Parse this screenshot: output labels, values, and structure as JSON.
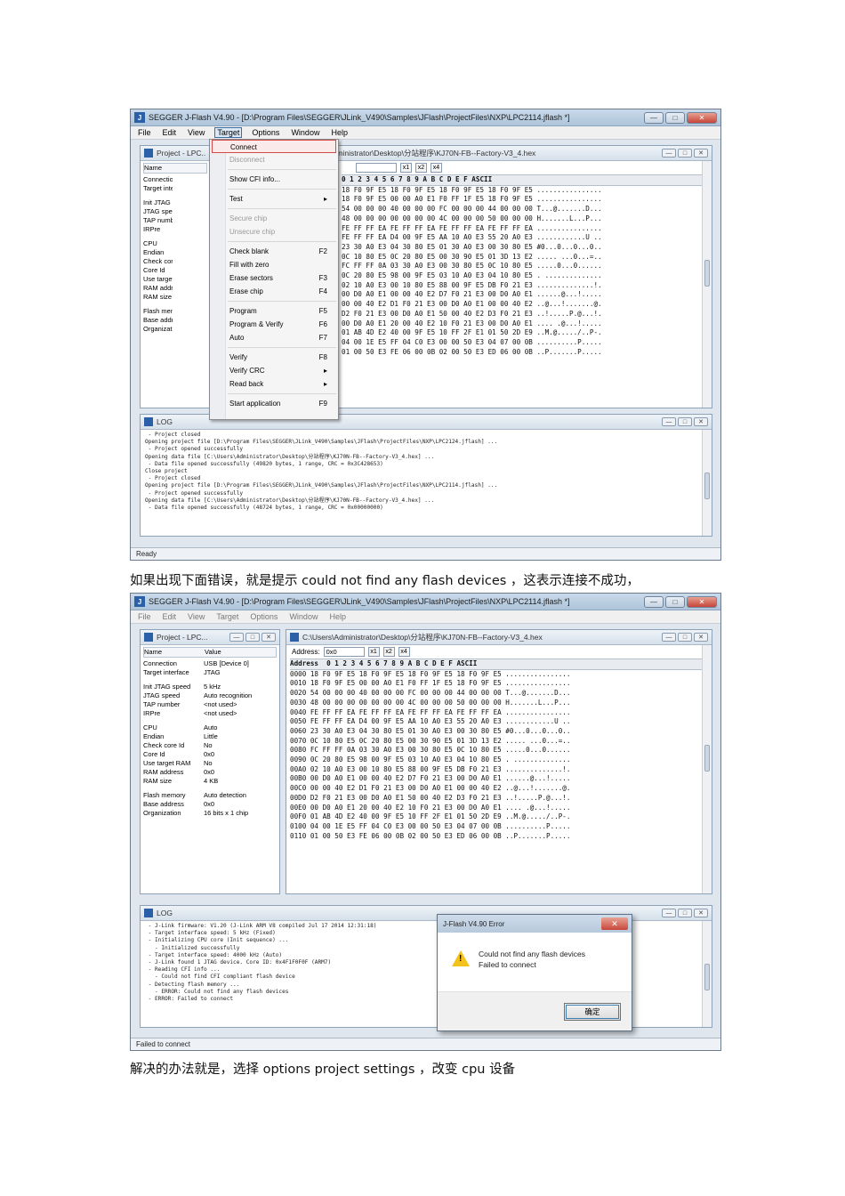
{
  "screenshot1": {
    "title": "SEGGER J-Flash V4.90 - [D:\\Program Files\\SEGGER\\JLink_V490\\Samples\\JFlash\\ProjectFiles\\NXP\\LPC2114.jflash *]",
    "menu": [
      "File",
      "Edit",
      "View",
      "Target",
      "Options",
      "Window",
      "Help"
    ],
    "active_menu": "Target",
    "project_title": "Project - LPC...",
    "project_rows": [
      [
        "Name",
        ""
      ],
      [
        "Connection",
        ""
      ],
      [
        "Target interface",
        ""
      ],
      [
        "",
        ""
      ],
      [
        "Init JTAG speed",
        ""
      ],
      [
        "JTAG speed",
        ""
      ],
      [
        "TAP number",
        ""
      ],
      [
        "IRPre",
        ""
      ],
      [
        "",
        ""
      ],
      [
        "CPU",
        ""
      ],
      [
        "Endian",
        ""
      ],
      [
        "Check core Id",
        ""
      ],
      [
        "Core Id",
        ""
      ],
      [
        "Use target RAM",
        ""
      ],
      [
        "RAM address",
        ""
      ],
      [
        "RAM size",
        ""
      ],
      [
        "",
        ""
      ],
      [
        "Flash memory",
        ""
      ],
      [
        "Base address",
        ""
      ],
      [
        "Organization",
        ""
      ]
    ],
    "hex_title": "Administrator\\Desktop\\分站程序\\KJ70N-FB--Factory-V3_4.hex",
    "address_value": "",
    "zoom": [
      "x1",
      "x2",
      "x4"
    ],
    "hex_header": "0 1 2 3 4 5 6 7 8 9 A B C D E F ASCII",
    "hex_lines": [
      "18 F0 9F E5 18 F0 9F E5 18 F0 9F E5 18 F0 9F E5 ................",
      "18 F0 9F E5 00 00 A0 E1 F0 FF 1F E5 18 F0 9F E5 ................",
      "54 00 00 00 40 00 00 00 FC 00 00 00 44 00 00 00 T...@.......D...",
      "48 00 00 00 00 00 00 00 4C 00 00 00 50 00 00 00 H.......L...P...",
      "FE FF FF EA FE FF FF EA FE FF FF EA FE FF FF EA ................",
      "FE FF FF EA D4 00 9F E5 AA 10 A0 E3 55 20 A0 E3 ............U ..",
      "23 30 A0 E3 04 30 80 E5 01 30 A0 E3 00 30 80 E5 #0...0...0...0..",
      "0C 10 80 E5 0C 20 80 E5 00 30 90 E5 01 3D 13 E2 ..... ...0...=..",
      "FC FF FF 0A 03 30 A0 E3 00 30 80 E5 0C 10 80 E5 .....0...0......",
      "0C 20 80 E5 98 00 9F E5 03 10 A0 E3 04 10 80 E5 . ..............",
      "02 10 A0 E3 00 10 80 E5 88 00 9F E5 DB F0 21 E3 ..............!.",
      "00 D0 A0 E1 00 00 40 E2 D7 F0 21 E3 00 D0 A0 E1 ......@...!.....",
      "00 00 40 E2 D1 F0 21 E3 00 D0 A0 E1 00 00 40 E2 ..@...!.......@.",
      "D2 F0 21 E3 00 D0 A0 E1 50 00 40 E2 D3 F0 21 E3 ..!.....P.@...!.",
      "00 D0 A0 E1 20 00 40 E2 10 F0 21 E3 00 D0 A0 E1 .... .@...!.....",
      "01 AB 4D E2 40 00 9F E5 10 FF 2F E1 01 50 2D E9 ..M.@...../..P-.",
      "04 00 1E E5 FF 04 C0 E3 00 00 50 E3 04 07 00 0B ..........P.....",
      "01 00 50 E3 FE 06 00 0B 02 00 50 E3 ED 06 00 0B ..P.......P....."
    ],
    "dropdown": [
      {
        "label": "Connect",
        "shortcut": "",
        "state": "highlighted"
      },
      {
        "label": "Disconnect",
        "shortcut": "",
        "state": "disabled"
      },
      {
        "sep": true
      },
      {
        "label": "Show CFI info...",
        "shortcut": "",
        "state": ""
      },
      {
        "sep": true
      },
      {
        "label": "Test",
        "shortcut": "▸",
        "state": ""
      },
      {
        "sep": true
      },
      {
        "label": "Secure chip",
        "shortcut": "",
        "state": "disabled"
      },
      {
        "label": "Unsecure chip",
        "shortcut": "",
        "state": "disabled"
      },
      {
        "sep": true
      },
      {
        "label": "Check blank",
        "shortcut": "F2",
        "state": ""
      },
      {
        "label": "Fill with zero",
        "shortcut": "",
        "state": ""
      },
      {
        "label": "Erase sectors",
        "shortcut": "F3",
        "state": ""
      },
      {
        "label": "Erase chip",
        "shortcut": "F4",
        "state": ""
      },
      {
        "sep": true
      },
      {
        "label": "Program",
        "shortcut": "F5",
        "state": ""
      },
      {
        "label": "Program & Verify",
        "shortcut": "F6",
        "state": ""
      },
      {
        "label": "Auto",
        "shortcut": "F7",
        "state": ""
      },
      {
        "sep": true
      },
      {
        "label": "Verify",
        "shortcut": "F8",
        "state": ""
      },
      {
        "label": "Verify CRC",
        "shortcut": "▸",
        "state": ""
      },
      {
        "label": "Read back",
        "shortcut": "▸",
        "state": ""
      },
      {
        "sep": true
      },
      {
        "label": "Start application",
        "shortcut": "F9",
        "state": ""
      }
    ],
    "log_title": "LOG",
    "log_lines": [
      " - Project closed",
      "Opening project file [D:\\Program Files\\SEGGER\\JLink_V490\\Samples\\JFlash\\ProjectFiles\\NXP\\LPC2124.jflash] ...",
      " - Project opened successfully",
      "Opening data file [C:\\Users\\Administrator\\Desktop\\分站程序\\KJ70N-FB--Factory-V3_4.hex] ...",
      " - Data file opened successfully (49820 bytes, 1 range, CRC = 0x3C428653)",
      "Close project",
      " - Project closed",
      "Opening project file [D:\\Program Files\\SEGGER\\JLink_V490\\Samples\\JFlash\\ProjectFiles\\NXP\\LPC2114.jflash] ...",
      " - Project opened successfully",
      "Opening data file [C:\\Users\\Administrator\\Desktop\\分站程序\\KJ70N-FB--Factory-V3_4.hex] ...",
      " - Data file opened successfully (48724 bytes, 1 range, CRC = 0x00000000)"
    ],
    "status": "Ready"
  },
  "caption1": "如果出现下面错误，就是提示 could not find any flash devices ，这表示连接不成功，",
  "screenshot2": {
    "title": "SEGGER J-Flash V4.90 - [D:\\Program Files\\SEGGER\\JLink_V490\\Samples\\JFlash\\ProjectFiles\\NXP\\LPC2114.jflash *]",
    "menu": [
      "File",
      "Edit",
      "View",
      "Target",
      "Options",
      "Window",
      "Help"
    ],
    "project_title": "Project - LPC...",
    "project_rows": [
      [
        "Name",
        "Value"
      ],
      [
        "Connection",
        "USB [Device 0]"
      ],
      [
        "Target interface",
        "JTAG"
      ],
      [
        "",
        ""
      ],
      [
        "Init JTAG speed",
        "5 kHz"
      ],
      [
        "JTAG speed",
        "Auto recognition"
      ],
      [
        "TAP number",
        "<not used>"
      ],
      [
        "IRPre",
        "<not used>"
      ],
      [
        "",
        ""
      ],
      [
        "CPU",
        "Auto"
      ],
      [
        "Endian",
        "Little"
      ],
      [
        "Check core Id",
        "No"
      ],
      [
        "Core Id",
        "0x0"
      ],
      [
        "Use target RAM",
        "No"
      ],
      [
        "RAM address",
        "0x0"
      ],
      [
        "RAM size",
        "4 KB"
      ],
      [
        "",
        ""
      ],
      [
        "Flash memory",
        "Auto detection"
      ],
      [
        "Base address",
        "0x0"
      ],
      [
        "Organization",
        "16 bits x 1 chip"
      ]
    ],
    "hex_title": "C:\\Users\\Administrator\\Desktop\\分站程序\\KJ70N-FB--Factory-V3_4.hex",
    "address_label": "Address:",
    "address_value": "0x0",
    "zoom": [
      "x1",
      "x2",
      "x4"
    ],
    "hex_header": "Address  0 1 2 3 4 5 6 7 8 9 A B C D E F ASCII",
    "hex_lines": [
      "0000 18 F0 9F E5 18 F0 9F E5 18 F0 9F E5 18 F0 9F E5 ................",
      "0010 18 F0 9F E5 00 00 A0 E1 F0 FF 1F E5 18 F0 9F E5 ................",
      "0020 54 00 00 00 40 00 00 00 FC 00 00 00 44 00 00 00 T...@.......D...",
      "0030 48 00 00 00 00 00 00 00 4C 00 00 00 50 00 00 00 H.......L...P...",
      "0040 FE FF FF EA FE FF FF EA FE FF FF EA FE FF FF EA ................",
      "0050 FE FF FF EA D4 00 9F E5 AA 10 A0 E3 55 20 A0 E3 ............U ..",
      "0060 23 30 A0 E3 04 30 80 E5 01 30 A0 E3 00 30 80 E5 #0...0...0...0..",
      "0070 0C 10 80 E5 0C 20 80 E5 00 30 90 E5 01 3D 13 E2 ..... ...0...=..",
      "0080 FC FF FF 0A 03 30 A0 E3 00 30 80 E5 0C 10 80 E5 .....0...0......",
      "0090 0C 20 80 E5 98 00 9F E5 03 10 A0 E3 04 10 80 E5 . ..............",
      "00A0 02 10 A0 E3 00 10 80 E5 88 00 9F E5 DB F0 21 E3 ..............!.",
      "00B0 00 D0 A0 E1 00 00 40 E2 D7 F0 21 E3 00 D0 A0 E1 ......@...!.....",
      "00C0 00 00 40 E2 D1 F0 21 E3 00 D0 A0 E1 00 00 40 E2 ..@...!.......@.",
      "00D0 D2 F0 21 E3 00 D0 A0 E1 50 00 40 E2 D3 F0 21 E3 ..!.....P.@...!.",
      "00E0 00 D0 A0 E1 20 00 40 E2 10 F0 21 E3 00 D0 A0 E1 .... .@...!.....",
      "00F0 01 AB 4D E2 40 00 9F E5 10 FF 2F E1 01 50 2D E9 ..M.@...../..P-.",
      "0100 04 00 1E E5 FF 04 C0 E3 00 00 50 E3 04 07 00 0B ..........P.....",
      "0110 01 00 50 E3 FE 06 00 0B 02 00 50 E3 ED 06 00 0B ..P.......P....."
    ],
    "log_title": "LOG",
    "log_lines": [
      " - J-Link firmware: V1.20 (J-Link ARM V8 compiled Jul 17 2014 12:31:18)",
      " - Target interface speed: 5 kHz (Fixed)",
      " - Initializing CPU core (Init sequence) ...",
      "   - Initialized successfully",
      " - Target interface speed: 4000 kHz (Auto)",
      " - J-Link found 1 JTAG device. Core ID: 0x4F1F0F0F (ARM7)",
      " - Reading CFI info ...",
      "   - Could not find CFI compliant flash device",
      " - Detecting flash memory ...",
      "   - ERROR: Could not find any flash devices",
      " - ERROR: Failed to connect"
    ],
    "error_dialog": {
      "title": "J-Flash V4.90 Error",
      "message1": "Could not find any flash devices",
      "message2": "Failed to connect",
      "ok": "确定"
    },
    "status": "Failed to connect"
  },
  "caption2": "解决的办法就是，选择 options   project settings ，改变 cpu 设备"
}
